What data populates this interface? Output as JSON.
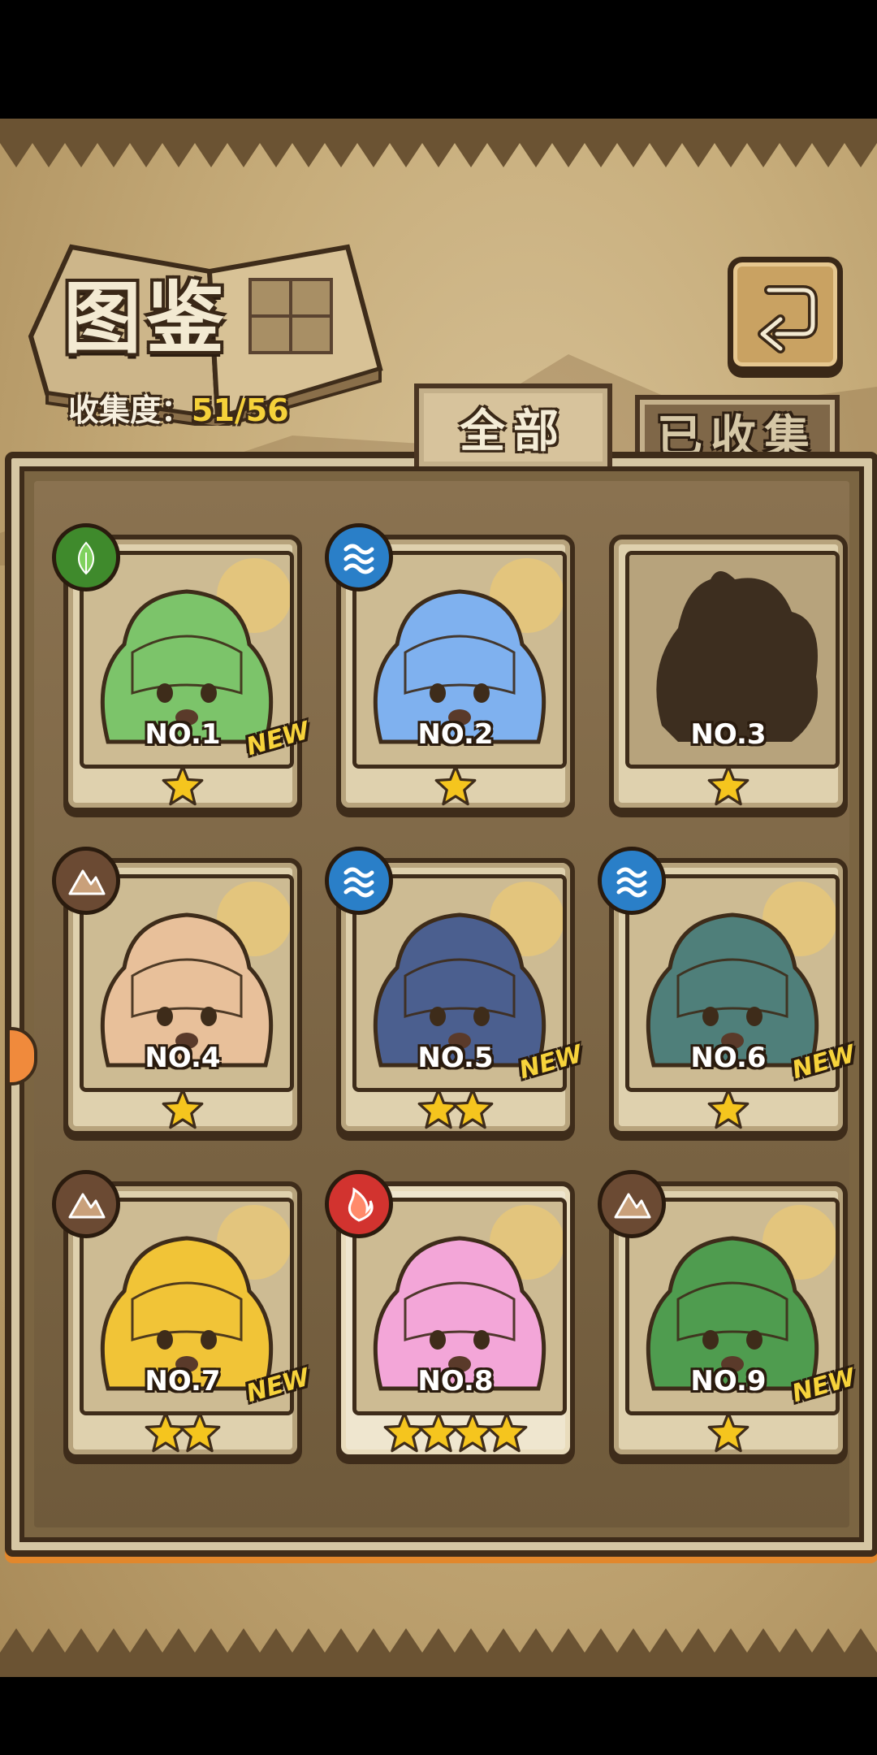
{
  "header": {
    "title": "图鉴",
    "collection_label": "收集度：",
    "collection_value": "51/56"
  },
  "tabs": [
    {
      "label": "全部",
      "active": true
    },
    {
      "label": "已收集",
      "active": false
    }
  ],
  "cards": [
    {
      "no": "NO.1",
      "element": "leaf",
      "element_color": "#3f8a2c",
      "stars": 1,
      "is_new": true,
      "locked": false,
      "theme": "#7cc46a"
    },
    {
      "no": "NO.2",
      "element": "water",
      "element_color": "#2a7fc8",
      "stars": 1,
      "is_new": false,
      "locked": false,
      "theme": "#7fb1ef"
    },
    {
      "no": "NO.3",
      "element": "none",
      "element_color": "",
      "stars": 1,
      "is_new": false,
      "locked": true,
      "theme": "#3d2e1f"
    },
    {
      "no": "NO.4",
      "element": "earth",
      "element_color": "#6b4a33",
      "stars": 1,
      "is_new": false,
      "locked": false,
      "theme": "#e8c09a"
    },
    {
      "no": "NO.5",
      "element": "water",
      "element_color": "#2a7fc8",
      "stars": 2,
      "is_new": true,
      "locked": false,
      "theme": "#4b5f8f"
    },
    {
      "no": "NO.6",
      "element": "water",
      "element_color": "#2a7fc8",
      "stars": 1,
      "is_new": true,
      "locked": false,
      "theme": "#4f7f7a"
    },
    {
      "no": "NO.7",
      "element": "earth",
      "element_color": "#6b4a33",
      "stars": 2,
      "is_new": true,
      "locked": false,
      "theme": "#f1c437"
    },
    {
      "no": "NO.8",
      "element": "fire",
      "element_color": "#d2332f",
      "stars": 4,
      "is_new": false,
      "locked": false,
      "theme": "#f3a6d8",
      "rare": true
    },
    {
      "no": "NO.9",
      "element": "earth",
      "element_color": "#6b4a33",
      "stars": 1,
      "is_new": true,
      "locked": false,
      "theme": "#4f9c4f"
    }
  ],
  "new_tag": "NEW",
  "colors": {
    "accent": "#e2872b",
    "star": "#f5c51e"
  }
}
